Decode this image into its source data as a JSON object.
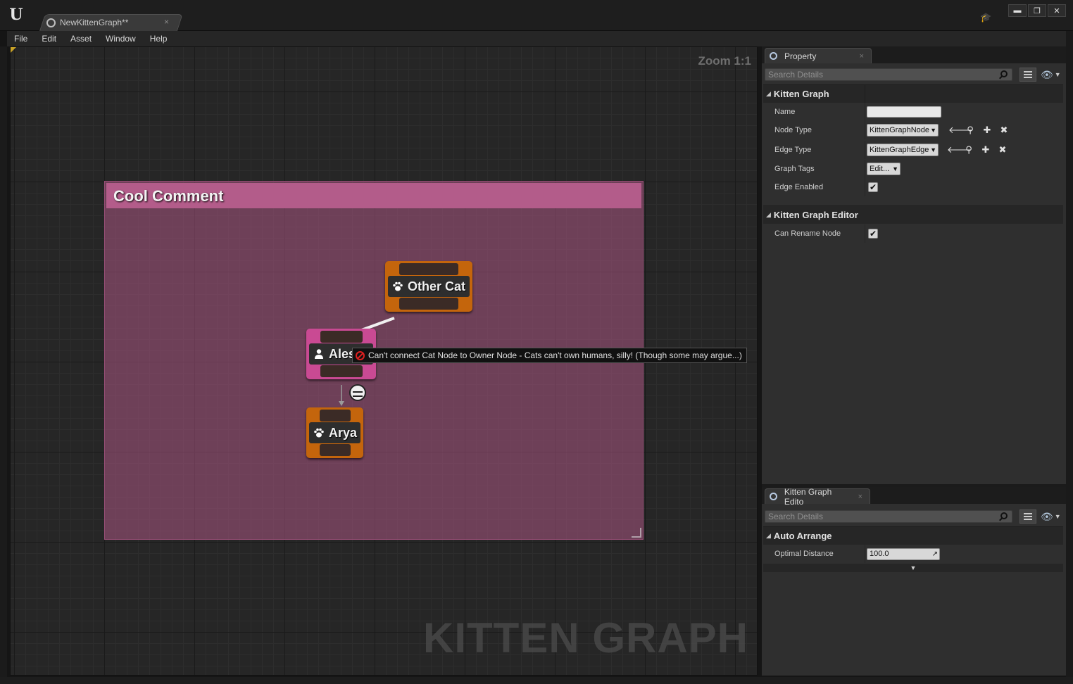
{
  "window": {
    "tab_title": "NewKittenGraph**",
    "tab_close": "×",
    "buttons": [
      "▬",
      "❐",
      "✕"
    ]
  },
  "menu": [
    "File",
    "Edit",
    "Asset",
    "Window",
    "Help"
  ],
  "graph": {
    "zoom": "Zoom 1:1",
    "watermark": "KITTEN GRAPH",
    "comment_title": "Cool Comment",
    "nodes": {
      "other_cat": "Other Cat",
      "owner": "Ales",
      "arya": "Arya"
    },
    "tooltip": "Can't connect Cat Node to Owner Node - Cats can't own humans, silly! (Though some may argue...)",
    "colors": {
      "cat_node": "#c4650c",
      "owner_node": "#c94a93",
      "comment": "#b35c8a"
    }
  },
  "property_panel": {
    "tab_title": "Property",
    "search_placeholder": "Search Details",
    "categories": {
      "kitten_graph": "Kitten Graph",
      "kitten_graph_editor": "Kitten Graph Editor"
    },
    "rows": {
      "name_label": "Name",
      "node_type_label": "Node Type",
      "node_type_value": "KittenGraphNode",
      "edge_type_label": "Edge Type",
      "edge_type_value": "KittenGraphEdge",
      "graph_tags_label": "Graph Tags",
      "graph_tags_value": "Edit...",
      "edge_enabled_label": "Edge Enabled",
      "can_rename_label": "Can Rename Node"
    }
  },
  "editor_panel": {
    "tab_title": "Kitten Graph Edito",
    "search_placeholder": "Search Details",
    "category": "Auto Arrange",
    "optimal_distance_label": "Optimal Distance",
    "optimal_distance_value": "100.0"
  }
}
